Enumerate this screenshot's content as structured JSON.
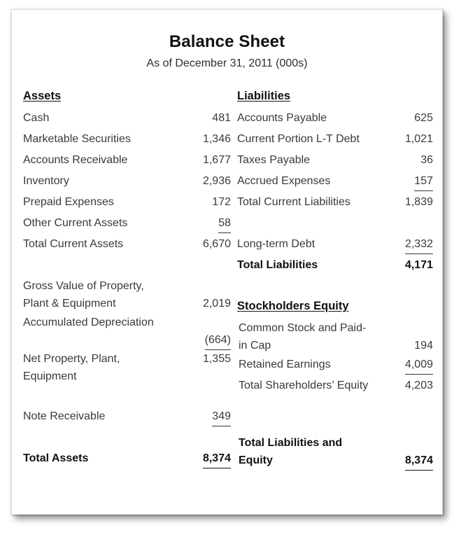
{
  "document": {
    "title": "Balance Sheet",
    "subtitle": "As of December 31, 2011 (000s)"
  },
  "assets": {
    "header": "Assets",
    "rows": [
      {
        "label": "Cash",
        "value": "481"
      },
      {
        "label": "Marketable Securities",
        "value": "1,346"
      },
      {
        "label": "Accounts Receivable",
        "value": "1,677"
      },
      {
        "label": "Inventory",
        "value": "2,936"
      },
      {
        "label": "Prepaid Expenses",
        "value": "172"
      },
      {
        "label": "Other Current Assets",
        "value": "58"
      },
      {
        "label": "Total Current Assets",
        "value": "6,670"
      },
      {
        "label": "",
        "value": ""
      },
      {
        "label": "Gross Value of Property, Plant & Equipment",
        "value": "2,019"
      },
      {
        "label": "Accumulated Depreciation",
        "value": "(664)"
      },
      {
        "label": "Net Property, Plant, Equipment",
        "value": "1,355"
      },
      {
        "label": "",
        "value": ""
      },
      {
        "label": "Note Receivable",
        "value": "349"
      },
      {
        "label": "",
        "value": ""
      },
      {
        "label": "Total Assets",
        "value": "8,374"
      }
    ]
  },
  "liabilities": {
    "header": "Liabilities",
    "rows": [
      {
        "label": "Accounts Payable",
        "value": "625"
      },
      {
        "label": "Current Portion L-T Debt",
        "value": "1,021"
      },
      {
        "label": "Taxes Payable",
        "value": "36"
      },
      {
        "label": "Accrued Expenses",
        "value": "157"
      },
      {
        "label": "Total Current Liabilities",
        "value": "1,839"
      },
      {
        "label": "",
        "value": ""
      },
      {
        "label": "Long-term Debt",
        "value": "2,332"
      },
      {
        "label": "Total Liabilities",
        "value": "4,171"
      }
    ]
  },
  "equity": {
    "header": "Stockholders Equity",
    "rows": [
      {
        "label": "Common Stock and Paid-in Cap",
        "value": "194"
      },
      {
        "label": "Retained Earnings",
        "value": "4,009"
      },
      {
        "label": "Total Shareholders’ Equity",
        "value": "4,203"
      },
      {
        "label": "",
        "value": ""
      },
      {
        "label": "Total Liabilities and Equity",
        "value": "8,374"
      }
    ]
  },
  "colors": {
    "body_text": "#3a3a3a",
    "emphasis_text": "#111111",
    "card_background": "#ffffff",
    "page_background": "#ffffff"
  }
}
